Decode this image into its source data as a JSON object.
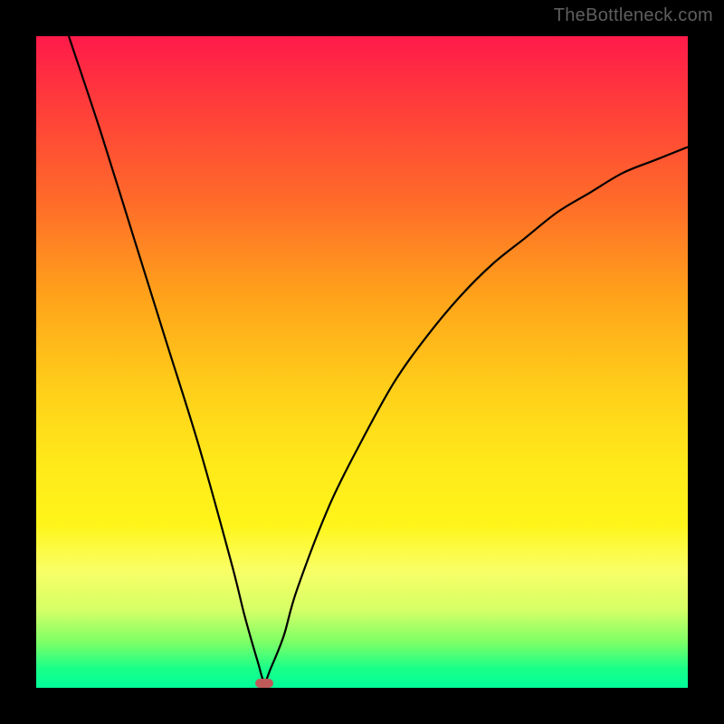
{
  "watermark": "TheBottleneck.com",
  "chart_data": {
    "type": "line",
    "title": "",
    "xlabel": "",
    "ylabel": "",
    "xlim": [
      0,
      100
    ],
    "ylim": [
      0,
      100
    ],
    "grid": false,
    "legend": false,
    "series": [
      {
        "name": "curve",
        "x": [
          5,
          10,
          15,
          20,
          25,
          30,
          32,
          34,
          35,
          36,
          38,
          40,
          45,
          50,
          55,
          60,
          65,
          70,
          75,
          80,
          85,
          90,
          95,
          100
        ],
        "y": [
          100,
          85,
          69,
          53,
          37,
          19,
          11,
          4,
          1,
          3,
          8,
          15,
          28,
          38,
          47,
          54,
          60,
          65,
          69,
          73,
          76,
          79,
          81,
          83
        ]
      }
    ],
    "annotations": [
      {
        "name": "min-marker",
        "x": 35,
        "y": 0.7
      }
    ],
    "background": {
      "type": "vertical-gradient",
      "stops": [
        {
          "pos": 0,
          "color": "#ff1a4a"
        },
        {
          "pos": 25,
          "color": "#ff6a2a"
        },
        {
          "pos": 55,
          "color": "#ffd11a"
        },
        {
          "pos": 82,
          "color": "#f9ff66"
        },
        {
          "pos": 97,
          "color": "#1aff88"
        },
        {
          "pos": 100,
          "color": "#00ff99"
        }
      ]
    }
  }
}
